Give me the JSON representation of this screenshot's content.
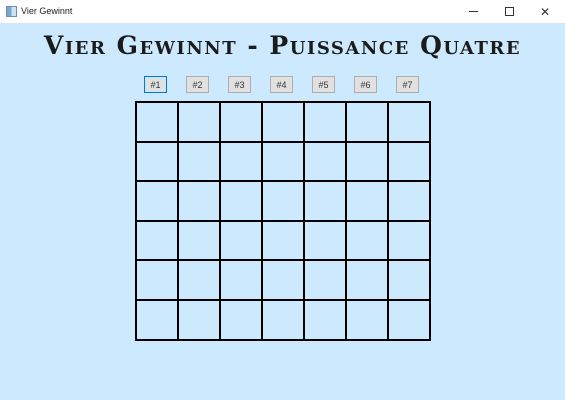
{
  "window": {
    "title": "Vier Gewinnt",
    "controls": {
      "minimize": "—",
      "maximize": "☐",
      "close": "✕"
    }
  },
  "game": {
    "title": "Vier Gewinnt - Puissance Quatre",
    "column_buttons": [
      {
        "label": "#1",
        "focused": true
      },
      {
        "label": "#2",
        "focused": false
      },
      {
        "label": "#3",
        "focused": false
      },
      {
        "label": "#4",
        "focused": false
      },
      {
        "label": "#5",
        "focused": false
      },
      {
        "label": "#6",
        "focused": false
      },
      {
        "label": "#7",
        "focused": false
      }
    ],
    "board": {
      "rows": 6,
      "columns": 7,
      "cells": [
        [
          "",
          "",
          "",
          "",
          "",
          "",
          ""
        ],
        [
          "",
          "",
          "",
          "",
          "",
          "",
          ""
        ],
        [
          "",
          "",
          "",
          "",
          "",
          "",
          ""
        ],
        [
          "",
          "",
          "",
          "",
          "",
          "",
          ""
        ],
        [
          "",
          "",
          "",
          "",
          "",
          "",
          ""
        ],
        [
          "",
          "",
          "",
          "",
          "",
          "",
          ""
        ]
      ]
    }
  },
  "colors": {
    "background": "#cce9fd",
    "grid_line": "#000000",
    "focus_border": "#0078d7"
  }
}
